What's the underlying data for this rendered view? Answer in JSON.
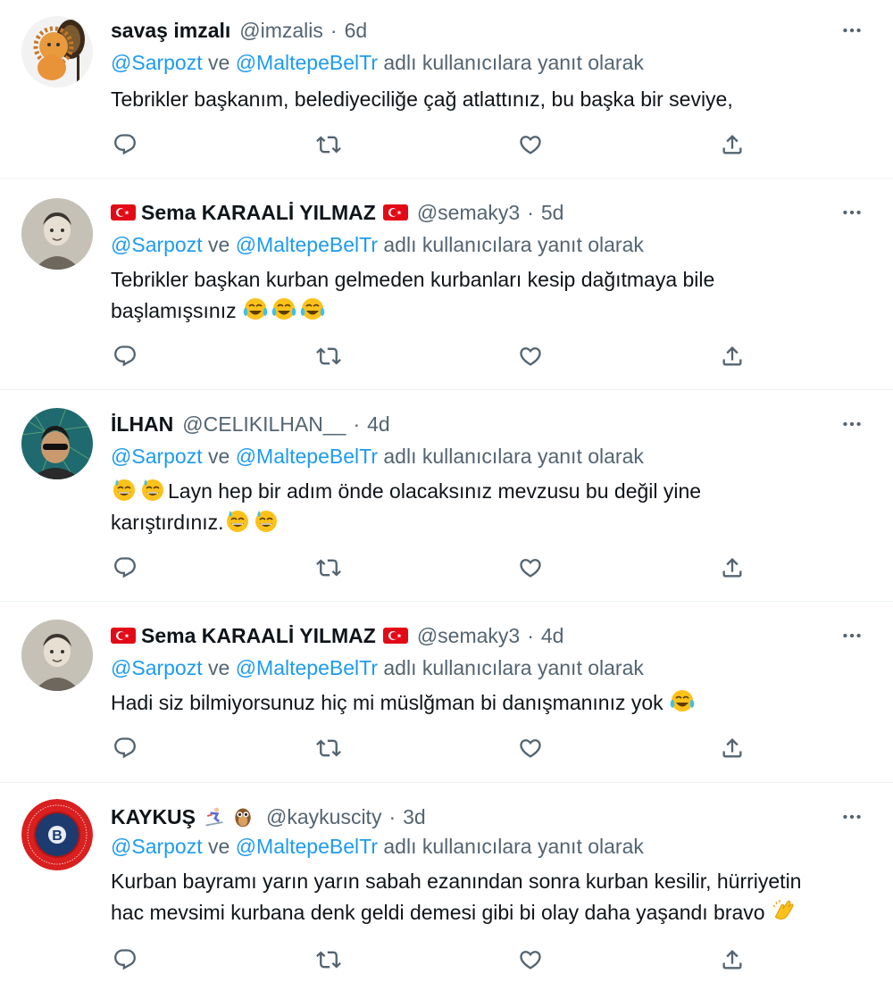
{
  "reply_prefix_users": [
    "@Sarpozt",
    "@MaltepeBelTr"
  ],
  "reply_joiner": "ve",
  "reply_suffix": "adlı kullanıcılara yanıt olarak",
  "separator": "·",
  "colors": {
    "link": "#1d9bf0",
    "secondary": "#536471",
    "text": "#0f1419",
    "divider": "#eff3f4"
  },
  "icons": [
    "reply-icon",
    "retweet-icon",
    "like-icon",
    "share-icon",
    "more-icon"
  ],
  "tweets": [
    {
      "name": "savaş imzalı",
      "handle": "@imzalis",
      "time": "6d",
      "lines": [
        "Tebrikler başkanım, belediyeciliğe çağ atlattınız, bu başka bir seviye,"
      ]
    },
    {
      "name": "Sema KARAALİ YILMAZ",
      "name_flags": [
        "flag-tr",
        "flag-tr"
      ],
      "handle": "@semaky3",
      "time": "5d",
      "lines": [
        "Tebrikler başkan kurban gelmeden kurbanları kesip dağıtmaya bile",
        "başlamışsınız"
      ],
      "emojis": [
        "face-with-tears-of-joy",
        "face-with-tears-of-joy",
        "face-with-tears-of-joy"
      ]
    },
    {
      "name": "İLHAN",
      "handle": "@CELIKILHAN__",
      "time": "4d",
      "lines": [
        "Layn hep bir adım önde olacaksınız mevzusu bu değil yine",
        "karıştırdınız."
      ],
      "emojis": [
        "grinning-face-with-sweat",
        "grinning-face-with-sweat"
      ]
    },
    {
      "name": "Sema KARAALİ YILMAZ",
      "name_flags": [
        "flag-tr",
        "flag-tr"
      ],
      "handle": "@semaky3",
      "time": "4d",
      "lines": [
        "Hadi siz bilmiyorsunuz hiç mi müslğman bi danışmanınız yok"
      ],
      "emojis": [
        "face-with-tears-of-joy"
      ]
    },
    {
      "name": "KAYKUŞ",
      "name_emojis": [
        "skier",
        "owl"
      ],
      "handle": "@kaykuscity",
      "time": "3d",
      "lines": [
        "Kurban bayramı yarın yarın sabah ezanından sonra kurban kesilir, hürriyetin",
        "hac mevsimi kurbana denk geldi demesi gibi bi olay daha yaşandı bravo"
      ],
      "emojis": [
        "clapping-hands"
      ],
      "avatar_ring_text": "ÜLKEMDE MÜLTECİ İSTEMİYORUM · SESSİZ İŞGALE DUR DE"
    }
  ]
}
